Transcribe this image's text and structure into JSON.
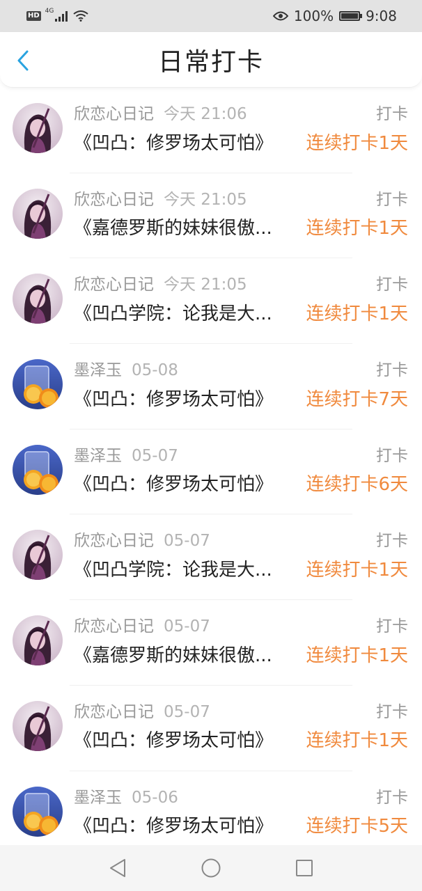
{
  "status_bar": {
    "hd": "HD",
    "network": "4G",
    "battery": "100%",
    "time": "9:08"
  },
  "header": {
    "title": "日常打卡"
  },
  "entries": [
    {
      "user": "欣恋心日记",
      "time": "今天 21:06",
      "tag": "打卡",
      "book": "《凹凸：修罗场太可怕》",
      "streak": "连续打卡1天",
      "avatar": "girl"
    },
    {
      "user": "欣恋心日记",
      "time": "今天 21:05",
      "tag": "打卡",
      "book": "《嘉德罗斯的妹妹很傲...",
      "streak": "连续打卡1天",
      "avatar": "girl"
    },
    {
      "user": "欣恋心日记",
      "time": "今天 21:05",
      "tag": "打卡",
      "book": "《凹凸学院：论我是大...",
      "streak": "连续打卡1天",
      "avatar": "girl"
    },
    {
      "user": "墨泽玉",
      "time": "05-08",
      "tag": "打卡",
      "book": "《凹凸：修罗场太可怕》",
      "streak": "连续打卡7天",
      "avatar": "lemon"
    },
    {
      "user": "墨泽玉",
      "time": "05-07",
      "tag": "打卡",
      "book": "《凹凸：修罗场太可怕》",
      "streak": "连续打卡6天",
      "avatar": "lemon"
    },
    {
      "user": "欣恋心日记",
      "time": "05-07",
      "tag": "打卡",
      "book": "《凹凸学院：论我是大...",
      "streak": "连续打卡1天",
      "avatar": "girl"
    },
    {
      "user": "欣恋心日记",
      "time": "05-07",
      "tag": "打卡",
      "book": "《嘉德罗斯的妹妹很傲...",
      "streak": "连续打卡1天",
      "avatar": "girl"
    },
    {
      "user": "欣恋心日记",
      "time": "05-07",
      "tag": "打卡",
      "book": "《凹凸：修罗场太可怕》",
      "streak": "连续打卡1天",
      "avatar": "girl"
    },
    {
      "user": "墨泽玉",
      "time": "05-06",
      "tag": "打卡",
      "book": "《凹凸：修罗场太可怕》",
      "streak": "连续打卡5天",
      "avatar": "lemon"
    }
  ],
  "colors": {
    "accent": "#29a3e0",
    "streak": "#f08a3e"
  }
}
